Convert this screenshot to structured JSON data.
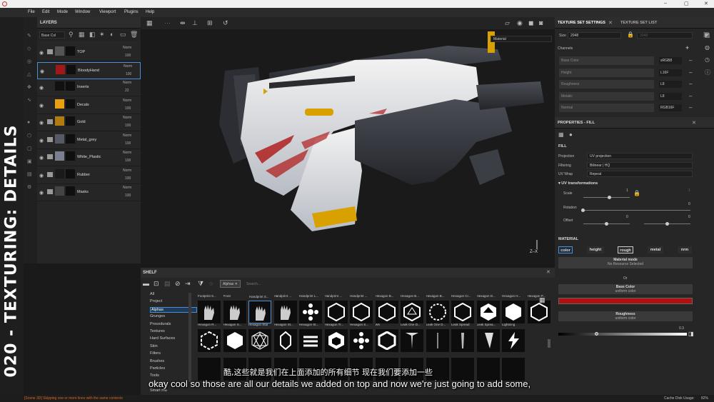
{
  "window": {
    "title_controls": [
      "–",
      "▢",
      "✕"
    ]
  },
  "menu": [
    "File",
    "Edit",
    "Mode",
    "Window",
    "Viewport",
    "Plugins",
    "Help"
  ],
  "side_title": "020 - TEXTURING: DETAILS",
  "layers": {
    "title": "LAYERS",
    "blend_select": "Base Col",
    "rows": [
      {
        "name": "TOP",
        "blend": "Norm",
        "opacity": "100",
        "type": "folder",
        "color": "#555555"
      },
      {
        "name": "BloodyHand",
        "blend": "Norm",
        "opacity": "100",
        "type": "fill",
        "color": "#a01818"
      },
      {
        "name": "Inserts",
        "blend": "Norm",
        "opacity": "22",
        "type": "fill",
        "color": "#111111"
      },
      {
        "name": "Decals",
        "blend": "Norm",
        "opacity": "100",
        "type": "fill",
        "color": "#e8a010"
      },
      {
        "name": "Gold",
        "blend": "Norm",
        "opacity": "100",
        "type": "folder",
        "color": "#b07c10"
      },
      {
        "name": "Metal_grey",
        "blend": "Norm",
        "opacity": "100",
        "type": "folder",
        "color": "#555a66"
      },
      {
        "name": "White_Plastic",
        "blend": "Norm",
        "opacity": "100",
        "type": "folder",
        "color": "#7a8090"
      },
      {
        "name": "Rubber",
        "blend": "Norm",
        "opacity": "100",
        "type": "folder",
        "color": "#1a1a1a"
      },
      {
        "name": "Masks",
        "blend": "Norm",
        "opacity": "100",
        "type": "folder",
        "color": "#444444"
      }
    ]
  },
  "viewport": {
    "material_select": "Material"
  },
  "texture_set": {
    "tabs": [
      "TEXTURE SET SETTINGS",
      "TEXTURE SET LIST"
    ],
    "size_label": "Size",
    "size_value": "2048",
    "size_linked": "2048",
    "channels_label": "Channels",
    "channels": [
      {
        "name": "Base Color",
        "format": "sRGB8"
      },
      {
        "name": "Height",
        "format": "L16F"
      },
      {
        "name": "Roughness",
        "format": "L8"
      },
      {
        "name": "Metalic",
        "format": "L8"
      },
      {
        "name": "Normal",
        "format": "RGB16F"
      }
    ]
  },
  "properties": {
    "title": "PROPERTIES - FILL",
    "fill_label": "FILL",
    "projection_label": "Projection",
    "projection": "UV projection",
    "filtering_label": "Filtering",
    "filtering": "Bilinear | HQ",
    "uvwrap_label": "UV Wrap",
    "uvwrap": "Repeat",
    "uvt_label": "UV transformations",
    "scale_label": "Scale",
    "scale_val": "1",
    "scale_val2": "1",
    "rotation_label": "Rotation",
    "rotation_val": "0",
    "offset_label": "Offset",
    "offset_val": "0",
    "offset_val2": "0",
    "material_label": "MATERIAL",
    "mat_buttons": [
      "color",
      "height",
      "rough",
      "metal",
      "nrm"
    ],
    "mat_mode_label": "Material mode",
    "mat_mode_value": "No Resource Selected",
    "or_label": "Or",
    "base_color_label": "Base Color",
    "base_color_sub": "uniform color",
    "base_color_hex": "#b01010",
    "roughness_label": "Roughness",
    "roughness_sub": "uniform color",
    "roughness_val": "0.3"
  },
  "shelf": {
    "title": "SHELF",
    "filter_tag": "Alphas",
    "search_placeholder": "Search...",
    "categories": [
      "All",
      "Project",
      "Alphas",
      "Grunges",
      "Procedurals",
      "Textures",
      "Hard Surfaces",
      "Skin",
      "Filters",
      "Brushes",
      "Particles",
      "Tools",
      "Materials",
      "Smart ma"
    ],
    "row1": [
      "Footprint S...",
      "Frost",
      "Handprint S...",
      "Handprint ...",
      "Handprint L...",
      "Handprint ...",
      "Handprint ...",
      "Hexagon B...",
      "Hexagon B...",
      "Hexagon B...",
      "Hexagon Cr...",
      "Hexagon D...",
      "Hexagon H...",
      "Hexagon P..."
    ],
    "row2": [
      "Hexagon R...",
      "Hexagon S...",
      "Hexagon Star",
      "Hexagon St...",
      "Hexagon St...",
      "Hexagon Tr...",
      "Hexagon S...",
      "Ws",
      "Leak One D...",
      "Leak One D...",
      "Leak Spread",
      "Leak Sprea...",
      "Lightning"
    ]
  },
  "subtitles": {
    "zh": "酷,这些就是我们在上面添加的所有细节 现在我们要添加一些",
    "en": "okay cool so those are all our details we added on top and now we're just going to add some,"
  },
  "status": {
    "message": "[Scene 3D] Skipping one or more lines with the same contents",
    "cache": "Cache Disk Usage:",
    "cache_val": "82%"
  }
}
